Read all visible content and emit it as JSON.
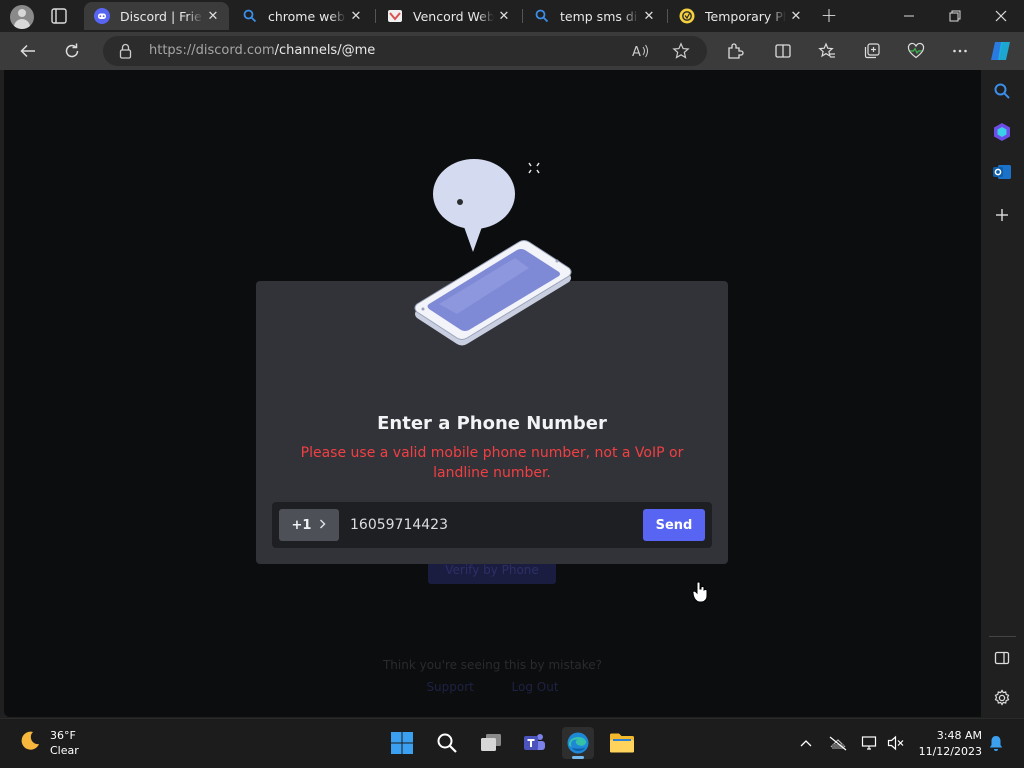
{
  "browser": {
    "tabs": [
      {
        "title": "Discord | Friend",
        "icon": "discord-icon",
        "active": true
      },
      {
        "title": "chrome web st",
        "icon": "search-icon",
        "active": false
      },
      {
        "title": "Vencord Web -",
        "icon": "vencord-icon",
        "active": false
      },
      {
        "title": "temp sms disco",
        "icon": "search-icon",
        "active": false
      },
      {
        "title": "Temporary Pho",
        "icon": "sms-site-icon",
        "active": false
      }
    ],
    "close_glyph": "✕",
    "new_tab_glyph": "+",
    "url_host": "https://discord.com",
    "url_path": "/channels/@me"
  },
  "background": {
    "faint_button": "Verify by Phone",
    "mistake_text": "Think you're seeing this by mistake?",
    "links": [
      "Support",
      "Log Out"
    ]
  },
  "modal": {
    "title": "Enter a Phone Number",
    "error": "Please use a valid mobile phone number, not a VoIP or landline number.",
    "country_code": "+1",
    "phone_value": "16059714423",
    "send_label": "Send"
  },
  "taskbar": {
    "temperature": "36°F",
    "condition": "Clear",
    "time": "3:48 AM",
    "date": "11/12/2023"
  },
  "colors": {
    "discord_blurple": "#5865f2",
    "error_red": "#f23f43",
    "modal_bg": "#313338"
  }
}
